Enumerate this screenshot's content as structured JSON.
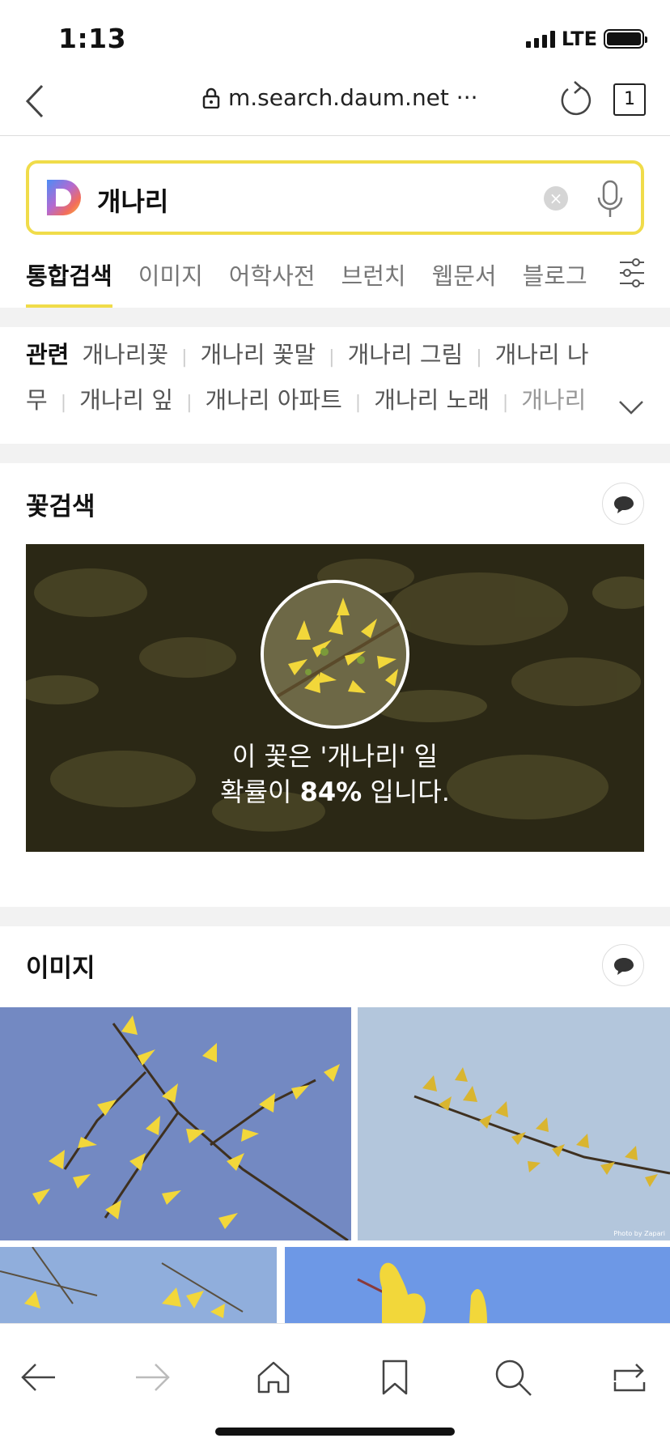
{
  "status": {
    "time": "1:13",
    "network": "LTE"
  },
  "browser": {
    "url": "m.search.daum.net ···",
    "tab_count": "1"
  },
  "search": {
    "query": "개나리"
  },
  "tabs": [
    "통합검색",
    "이미지",
    "어학사전",
    "브런치",
    "웹문서",
    "블로그"
  ],
  "related": {
    "label": "관련",
    "items": [
      "개나리꽃",
      "개나리 꽃말",
      "개나리 그림",
      "개나리 나무",
      "개나리 잎",
      "개나리 아파트",
      "개나리 노래",
      "개나리"
    ]
  },
  "flower_search": {
    "title": "꽃검색",
    "line1": "이 꽃은 '개나리' 일",
    "line2_prefix": "확률이 ",
    "probability": "84%",
    "line2_suffix": " 입니다."
  },
  "images": {
    "title": "이미지",
    "credit": "Photo by Zapari"
  },
  "colors": {
    "accent": "#f0dc4a",
    "sky": "#6b8cc9",
    "flower": "#f2d73a"
  }
}
